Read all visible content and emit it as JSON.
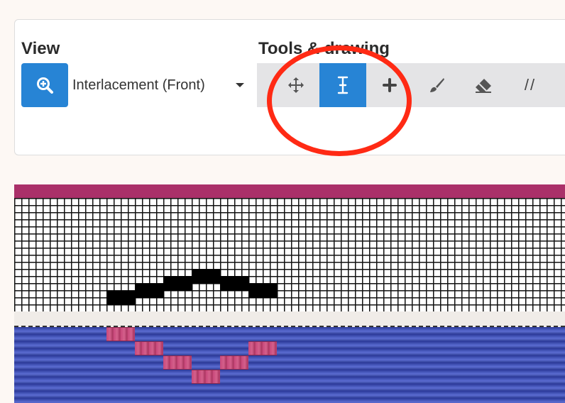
{
  "view": {
    "label": "View",
    "zoom_icon": "zoom-in-icon",
    "select_value": "Interlacement (Front)"
  },
  "tools": {
    "label": "Tools & drawing",
    "items": [
      {
        "icon": "move-icon",
        "active": false
      },
      {
        "icon": "text-cursor-icon",
        "active": true
      },
      {
        "icon": "plus-icon",
        "active": false
      },
      {
        "icon": "brush-icon",
        "active": false
      },
      {
        "icon": "eraser-icon",
        "active": false
      },
      {
        "icon": "line-tool-icon",
        "text": "//",
        "active": false
      }
    ]
  },
  "colors": {
    "accent": "#2784d5",
    "highlight": "#ff2a14",
    "weft_strip": "#aa3069",
    "warp": "#3a4aa4",
    "float": "#c8487a"
  },
  "draft": {
    "filled_cells": [
      [
        13,
        14
      ],
      [
        17,
        13
      ],
      [
        21,
        12
      ],
      [
        25,
        11
      ],
      [
        29,
        12
      ],
      [
        33,
        13
      ]
    ],
    "floats": [
      [
        13,
        0
      ],
      [
        17,
        1
      ],
      [
        21,
        2
      ],
      [
        25,
        3
      ],
      [
        29,
        2
      ],
      [
        33,
        1
      ]
    ]
  }
}
